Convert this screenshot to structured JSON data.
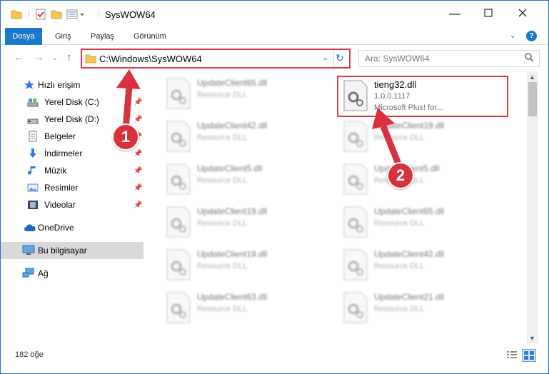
{
  "window": {
    "title": "SysWOW64",
    "minimize_icon": "minimize-icon",
    "maximize_icon": "maximize-icon",
    "close_icon": "close-icon"
  },
  "ribbon": {
    "tabs": [
      "Dosya",
      "Giriş",
      "Paylaş",
      "Görünüm"
    ],
    "active_tab": "Dosya",
    "help_label": "?"
  },
  "address": {
    "path": "C:\\Windows\\SysWOW64",
    "search_placeholder": "Ara: SysWOW64"
  },
  "sidebar": {
    "items": [
      {
        "label": "Hızlı erişim",
        "icon": "star-icon",
        "pinned": false
      },
      {
        "label": "Yerel Disk (C:)",
        "icon": "drive-icon",
        "pinned": true
      },
      {
        "label": "Yerel Disk (D:)",
        "icon": "drive-icon",
        "pinned": true
      },
      {
        "label": "Belgeler",
        "icon": "document-icon",
        "pinned": true
      },
      {
        "label": "İndirmeler",
        "icon": "download-icon",
        "pinned": true
      },
      {
        "label": "Müzik",
        "icon": "music-icon",
        "pinned": true
      },
      {
        "label": "Resimler",
        "icon": "pictures-icon",
        "pinned": true
      },
      {
        "label": "Videolar",
        "icon": "video-icon",
        "pinned": true
      },
      {
        "label": "OneDrive",
        "icon": "cloud-icon",
        "pinned": false
      },
      {
        "label": "Bu bilgisayar",
        "icon": "computer-icon",
        "pinned": false
      },
      {
        "label": "Ağ",
        "icon": "network-icon",
        "pinned": false
      }
    ],
    "selected": "Bu bilgisayar"
  },
  "files": {
    "highlighted": {
      "name": "tieng32.dll",
      "version": "1.0.0.1117",
      "description": "Microsoft Plus! for..."
    },
    "left_column": [
      {
        "name": "UpdateClient65.dll",
        "type": "Resource DLL"
      },
      {
        "name": "UpdateClient42.dll",
        "type": "Resource DLL"
      },
      {
        "name": "UpdateClient5.dll",
        "type": "Resource DLL"
      },
      {
        "name": "UpdateClient19.dll",
        "type": "Resource DLL"
      },
      {
        "name": "UpdateClient19.dll",
        "type": "Resource DLL"
      },
      {
        "name": "UpdateClient63.dll",
        "type": "Resource DLL"
      }
    ],
    "right_column": [
      {
        "name": "UpdateClient19.dll",
        "type": "Resource DLL"
      },
      {
        "name": "UpdateClient5.dll",
        "type": "Resource DLL"
      },
      {
        "name": "UpdateClient65.dll",
        "type": "Resource DLL"
      },
      {
        "name": "UpdateClient42.dll",
        "type": "Resource DLL"
      },
      {
        "name": "UpdateClient21.dll",
        "type": "Resource DLL"
      }
    ]
  },
  "status": {
    "item_count": "182 öğe"
  },
  "annotations": {
    "step1": "1",
    "step2": "2",
    "color": "#d8323e"
  },
  "colors": {
    "accent": "#1979ca",
    "highlight_border": "#d93b47"
  }
}
